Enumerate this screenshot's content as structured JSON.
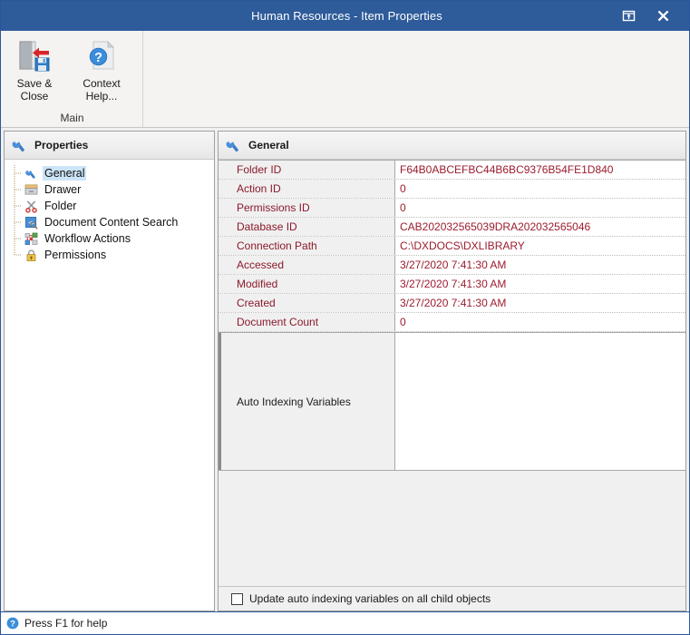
{
  "titlebar": {
    "title": "Human Resources - Item Properties",
    "restore_icon": "restore-window-icon",
    "close_icon": "close-icon"
  },
  "ribbon": {
    "group_title": "Main",
    "buttons": [
      {
        "label": "Save &\nClose",
        "icon": "save-and-close-icon"
      },
      {
        "label": "Context\nHelp...",
        "icon": "context-help-icon"
      }
    ]
  },
  "sidebar": {
    "header": "Properties",
    "header_icon": "wrench-icon",
    "items": [
      {
        "label": "General",
        "icon": "wrench-icon",
        "selected": true
      },
      {
        "label": "Drawer",
        "icon": "drawer-icon",
        "selected": false
      },
      {
        "label": "Folder",
        "icon": "scissors-icon",
        "selected": false
      },
      {
        "label": "Document Content Search",
        "icon": "document-search-icon",
        "selected": false
      },
      {
        "label": "Workflow Actions",
        "icon": "workflow-icon",
        "selected": false
      },
      {
        "label": "Permissions",
        "icon": "padlock-icon",
        "selected": false
      }
    ]
  },
  "content": {
    "header": "General",
    "header_icon": "wrench-icon",
    "rows": [
      {
        "label": "Folder ID",
        "value": "F64B0ABCEFBC44B6BC9376B54FE1D840"
      },
      {
        "label": "Action ID",
        "value": "0"
      },
      {
        "label": "Permissions ID",
        "value": "0"
      },
      {
        "label": "Database ID",
        "value": "CAB202032565039DRA202032565046"
      },
      {
        "label": "Connection Path",
        "value": "C:\\DXDOCS\\DXLIBRARY"
      },
      {
        "label": "Accessed",
        "value": "3/27/2020 7:41:30 AM"
      },
      {
        "label": "Modified",
        "value": "3/27/2020 7:41:30 AM"
      },
      {
        "label": "Created",
        "value": "3/27/2020 7:41:30 AM"
      },
      {
        "label": "Document Count",
        "value": "0"
      }
    ],
    "auto_indexing": {
      "label": "Auto Indexing Variables",
      "value": ""
    },
    "checkbox": {
      "label": "Update auto indexing variables on all child objects",
      "checked": false
    }
  },
  "statusbar": {
    "icon": "help-circle-icon",
    "text": "Press F1 for help"
  },
  "colors": {
    "titlebar": "#2e5b9a",
    "accent": "#2e5b9a",
    "property_text": "#9b1c2e",
    "selection": "#cce4f7"
  }
}
